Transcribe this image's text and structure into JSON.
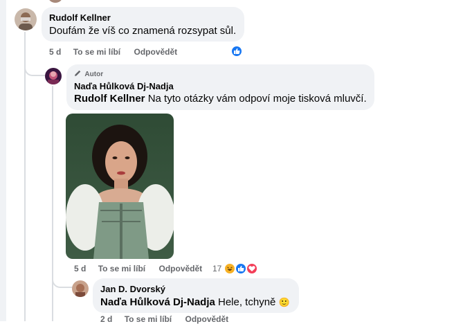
{
  "comments": [
    {
      "author": "Rudolf Kellner",
      "text": "Doufám že víš co znamená rozsypat sůl.",
      "time": "5 d",
      "like": "To se mi líbí",
      "reply": "Odpovědět",
      "reaction_icons": [
        "like-reaction-icon"
      ]
    },
    {
      "badge": "Autor",
      "author": "Naďa Hůlková Dj-Nadja",
      "mention": "Rudolf Kellner",
      "text": "Na tyto otázky vám odpoví moje tisková mluvčí.",
      "time": "5 d",
      "like": "To se mi líbí",
      "reply": "Odpovědět",
      "reaction_count": "17",
      "reaction_icons": [
        "haha-reaction-icon",
        "like-reaction-icon",
        "love-reaction-icon"
      ]
    },
    {
      "author": "Jan D. Dvorský",
      "mention": "Naďa Hůlková Dj-Nadja",
      "text": "Hele, tchyně",
      "emoji": "🙂",
      "time": "2 d",
      "like": "To se mi líbí",
      "reply": "Odpovědět"
    }
  ],
  "colors": {
    "like_blue": "#1877f2",
    "love_red": "#f33e58",
    "haha_yellow": "#f7b125",
    "bubble_bg": "#f0f2f5",
    "meta_gray": "#65676b"
  }
}
